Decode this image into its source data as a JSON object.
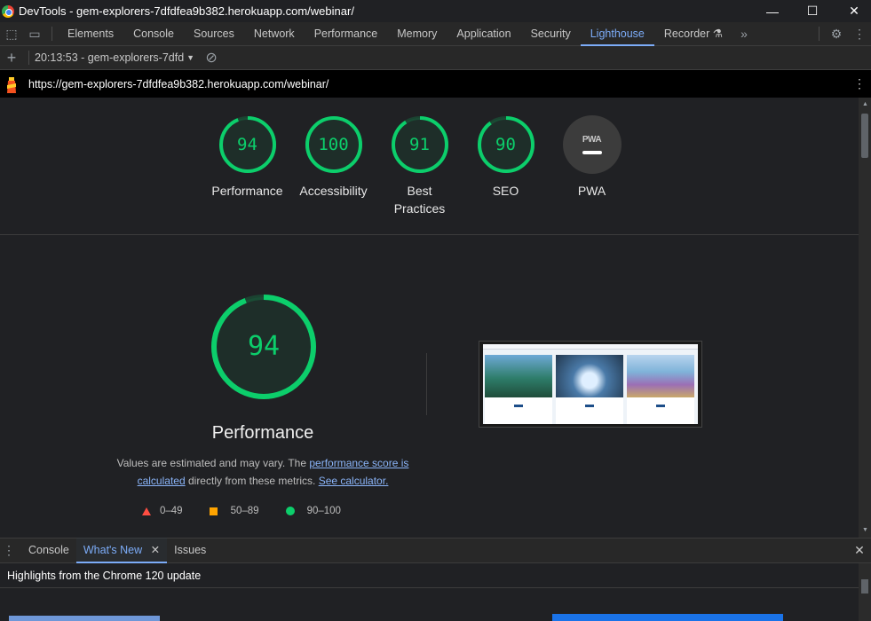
{
  "window": {
    "title": "DevTools - gem-explorers-7dfdfea9b382.herokuapp.com/webinar/",
    "minimize": "—",
    "maximize": "☐",
    "close": "✕"
  },
  "tabs": [
    {
      "label": "Elements"
    },
    {
      "label": "Console"
    },
    {
      "label": "Sources"
    },
    {
      "label": "Network"
    },
    {
      "label": "Performance"
    },
    {
      "label": "Memory"
    },
    {
      "label": "Application"
    },
    {
      "label": "Security"
    },
    {
      "label": "Lighthouse"
    },
    {
      "label": "Recorder"
    }
  ],
  "toolbar": {
    "report_select": "20:13:53 - gem-explorers-7dfd"
  },
  "url": "https://gem-explorers-7dfdfea9b382.herokuapp.com/webinar/",
  "scores": [
    {
      "label": "Performance",
      "value": "94",
      "fraction": 0.94
    },
    {
      "label": "Accessibility",
      "value": "100",
      "fraction": 1.0
    },
    {
      "label": "Best Practices",
      "value": "91",
      "fraction": 0.91
    },
    {
      "label": "SEO",
      "value": "90",
      "fraction": 0.9
    },
    {
      "label": "PWA",
      "badge": "PWA"
    }
  ],
  "performance": {
    "score": "94",
    "fraction": 0.94,
    "title": "Performance",
    "desc_prefix": "Values are estimated and may vary. The ",
    "link_score": "performance score is calculated",
    "desc_mid": " directly from these metrics. ",
    "link_calc": "See calculator.",
    "legend": [
      {
        "label": "0–49",
        "color": "#ff4e42"
      },
      {
        "label": "50–89",
        "color": "#ffa400"
      },
      {
        "label": "90–100",
        "color": "#0cce6b"
      }
    ]
  },
  "drawer": {
    "tabs": [
      {
        "label": "Console"
      },
      {
        "label": "What's New"
      },
      {
        "label": "Issues"
      }
    ],
    "highlights": "Highlights from the Chrome 120 update"
  },
  "colors": {
    "pass": "#0cce6b",
    "accent": "#7cacf8"
  }
}
